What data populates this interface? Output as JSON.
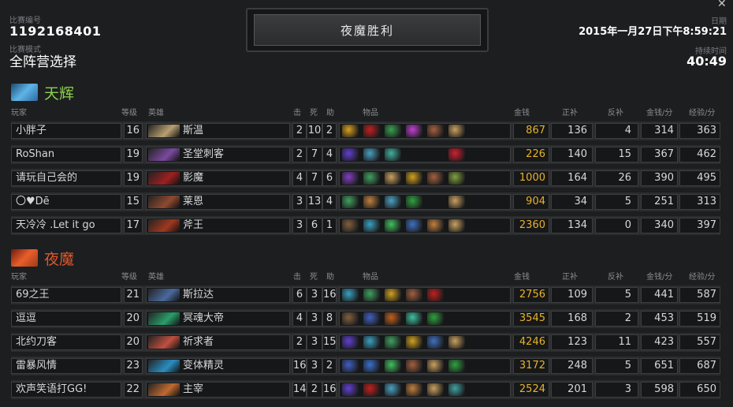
{
  "header": {
    "match_id_label": "比赛编号",
    "match_id": "1192168401",
    "mode_label": "比赛模式",
    "mode": "全阵营选择",
    "winner_text": "夜魔胜利",
    "date_label": "日期",
    "date": "2015年一月27日下午8:59:21",
    "duration_label": "持续时间",
    "duration": "40:49",
    "close_glyph": "✕"
  },
  "columns": {
    "player": "玩家",
    "level": "等级",
    "hero": "英雄",
    "kills": "击",
    "deaths": "死",
    "assists": "助",
    "items": "物品",
    "gold": "金钱",
    "last_hits": "正补",
    "denies": "反补",
    "gpm": "金钱/分",
    "xpm": "经验/分"
  },
  "teams": [
    {
      "name": "天辉",
      "accent": "#8cd04a",
      "players": [
        {
          "player": "小胖子",
          "level": "16",
          "hero": "斯温",
          "k": "2",
          "d": "10",
          "a": "2",
          "gold": "867",
          "lh": "136",
          "dn": "4",
          "gpm": "314",
          "xpm": "363",
          "hero_color": "#b8a070",
          "items": [
            "#d8a020",
            "#c02020",
            "#3aa050",
            "#c040d0",
            "#a06040",
            "#c8a060"
          ]
        },
        {
          "player": "RoShan",
          "level": "19",
          "hero": "圣堂刺客",
          "k": "2",
          "d": "7",
          "a": "4",
          "gold": "226",
          "lh": "140",
          "dn": "15",
          "gpm": "367",
          "xpm": "462",
          "hero_color": "#7a4a9e",
          "items": [
            "#6040d0",
            "#4aa0c0",
            "#40b0a0",
            "#222222",
            "#222222",
            "#d02030"
          ]
        },
        {
          "player": "请玩自己会的",
          "level": "19",
          "hero": "影魔",
          "k": "4",
          "d": "7",
          "a": "6",
          "gold": "1000",
          "lh": "164",
          "dn": "26",
          "gpm": "390",
          "xpm": "495",
          "hero_color": "#9e2020",
          "items": [
            "#8040c0",
            "#40a060",
            "#c8a060",
            "#d0a020",
            "#a06040",
            "#80a040"
          ]
        },
        {
          "player": "〇♥Dē",
          "level": "15",
          "hero": "莱恩",
          "k": "3",
          "d": "13",
          "a": "4",
          "gold": "904",
          "lh": "34",
          "dn": "5",
          "gpm": "251",
          "xpm": "313",
          "hero_color": "#8e4a30",
          "items": [
            "#40a060",
            "#c08040",
            "#4aa0c0",
            "#30a040",
            "#222222",
            "#c8a060"
          ]
        },
        {
          "player": "天冷冷 .Let it go",
          "level": "17",
          "hero": "斧王",
          "k": "3",
          "d": "6",
          "a": "1",
          "gold": "2360",
          "lh": "134",
          "dn": "0",
          "gpm": "340",
          "xpm": "397",
          "hero_color": "#a03820",
          "items": [
            "#806040",
            "#3aa0c0",
            "#40c060",
            "#4070c0",
            "#c08040",
            "#c8a060"
          ]
        }
      ]
    },
    {
      "name": "夜魔",
      "accent": "#e0562a",
      "players": [
        {
          "player": "69之王",
          "level": "21",
          "hero": "斯拉达",
          "k": "6",
          "d": "3",
          "a": "16",
          "gold": "2756",
          "lh": "109",
          "dn": "5",
          "gpm": "441",
          "xpm": "587",
          "hero_color": "#4a6a9e",
          "items": [
            "#3aa0c0",
            "#40a060",
            "#d0a020",
            "#a06040",
            "#c02020",
            "#222222"
          ]
        },
        {
          "player": "逗逗",
          "level": "20",
          "hero": "冥魂大帝",
          "k": "4",
          "d": "3",
          "a": "8",
          "gold": "3545",
          "lh": "168",
          "dn": "2",
          "gpm": "453",
          "xpm": "519",
          "hero_color": "#2a9e6a",
          "items": [
            "#806040",
            "#4060c0",
            "#c06020",
            "#40c0a0",
            "#30a040",
            "#222222"
          ]
        },
        {
          "player": "北约刀客",
          "level": "20",
          "hero": "祈求者",
          "k": "2",
          "d": "3",
          "a": "15",
          "gold": "4246",
          "lh": "123",
          "dn": "11",
          "gpm": "423",
          "xpm": "557",
          "hero_color": "#c05040",
          "items": [
            "#6040d0",
            "#3aa0c0",
            "#40a060",
            "#d0a020",
            "#4070c0",
            "#c8a060"
          ]
        },
        {
          "player": "雷暴风情",
          "level": "23",
          "hero": "变体精灵",
          "k": "16",
          "d": "3",
          "a": "2",
          "gold": "3172",
          "lh": "248",
          "dn": "5",
          "gpm": "651",
          "xpm": "687",
          "hero_color": "#2a8ec0",
          "items": [
            "#4060c0",
            "#3a70d0",
            "#40c060",
            "#a06040",
            "#c8a060",
            "#30a040"
          ]
        },
        {
          "player": "欢声笑语打GG!",
          "level": "22",
          "hero": "主宰",
          "k": "14",
          "d": "2",
          "a": "16",
          "gold": "2524",
          "lh": "201",
          "dn": "3",
          "gpm": "598",
          "xpm": "650",
          "hero_color": "#c06a30",
          "items": [
            "#6040d0",
            "#c02020",
            "#4aa0c0",
            "#c08040",
            "#c8a060",
            "#40a0a0"
          ]
        }
      ]
    }
  ]
}
